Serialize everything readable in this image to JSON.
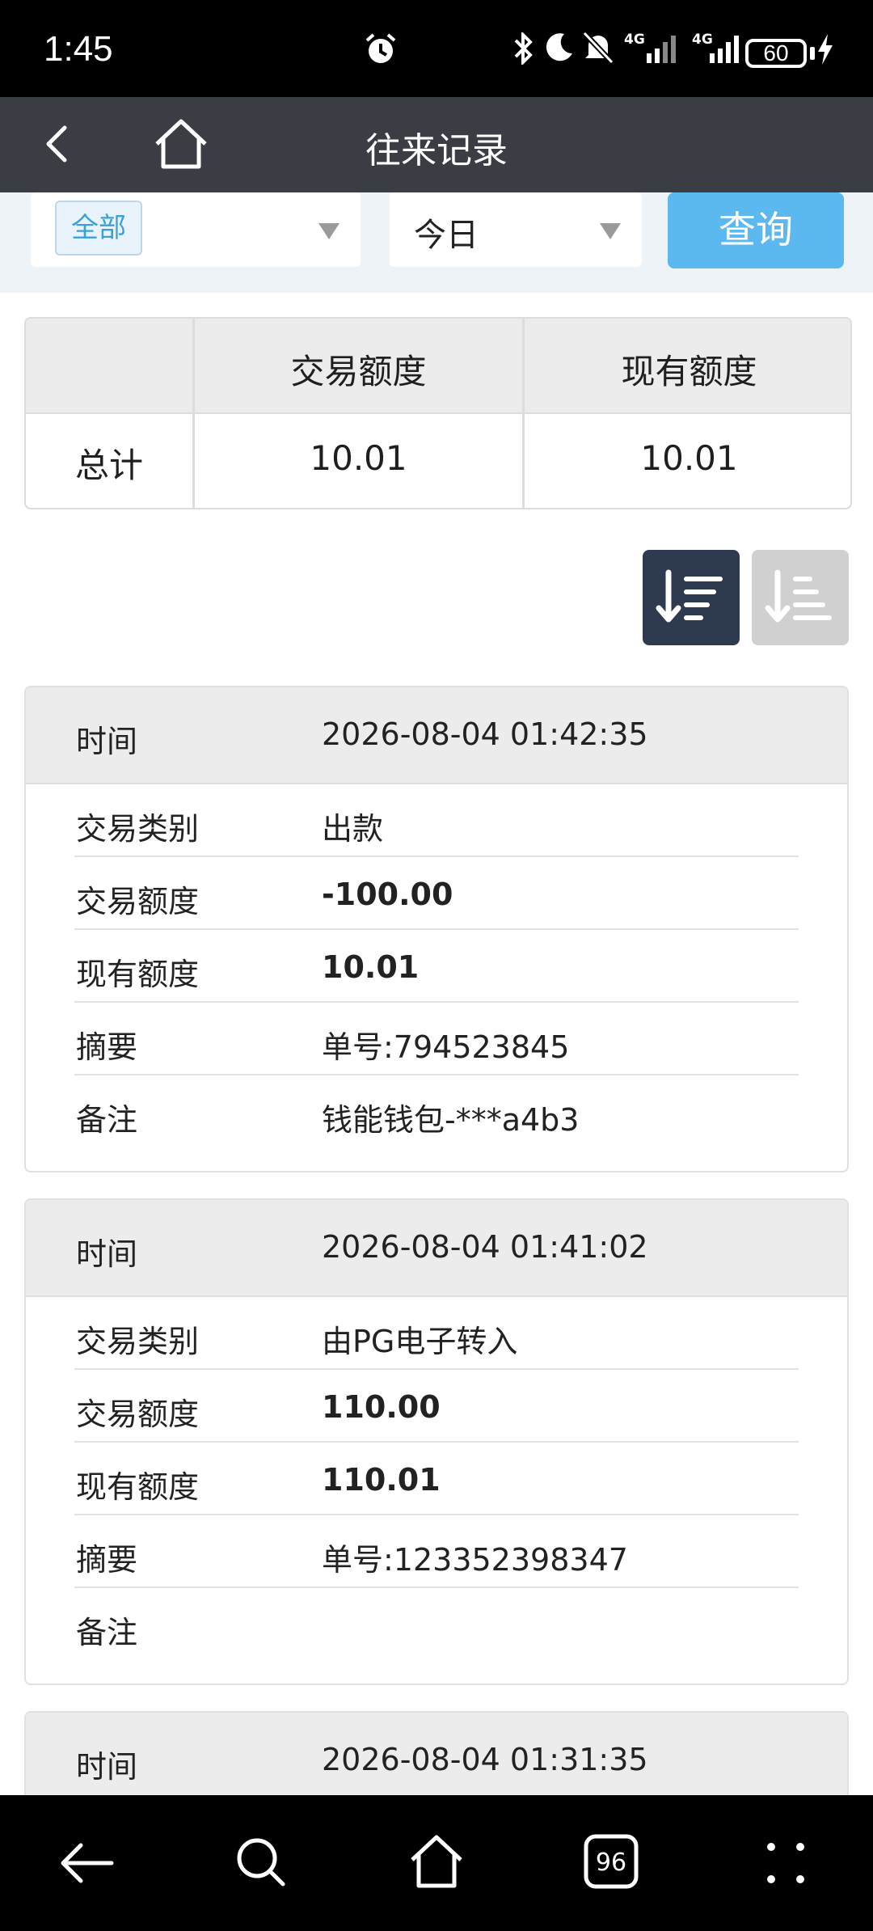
{
  "status_bar": {
    "time": "1:45",
    "network_1": "4G",
    "network_2": "4G",
    "battery": "60",
    "icons": [
      "alarm-icon",
      "bluetooth-icon",
      "moon-icon",
      "mute-icon",
      "signal-icon",
      "signal-icon",
      "charging-icon"
    ]
  },
  "header": {
    "title": "往来记录",
    "icons": [
      "back-icon",
      "home-icon"
    ]
  },
  "filters": {
    "category_tag": "全部",
    "date_value": "今日",
    "query_label": "查询"
  },
  "summary": {
    "col_trade": "交易额度",
    "col_current": "现有额度",
    "row_label": "总计",
    "trade_total": "10.01",
    "current_total": "10.01"
  },
  "sort": {
    "icons": [
      "sort-desc-icon",
      "sort-asc-icon"
    ],
    "active": "desc"
  },
  "labels": {
    "time": "时间",
    "type": "交易类别",
    "trade": "交易额度",
    "current": "现有额度",
    "summary": "摘要",
    "remark": "备注"
  },
  "records": [
    {
      "time": "2026-08-04 01:42:35",
      "type": "出款",
      "trade": "-100.00",
      "current": "10.01",
      "summary": "单号:794523845",
      "remark": "钱能钱包-***a4b3"
    },
    {
      "time": "2026-08-04 01:41:02",
      "type": "由PG电子转入",
      "trade": "110.00",
      "current": "110.01",
      "summary": "单号:123352398347",
      "remark": ""
    },
    {
      "time": "2026-08-04 01:31:35"
    }
  ],
  "nav_bar": {
    "tabs_count": "96",
    "icons": [
      "back-arrow-icon",
      "search-icon",
      "home-icon",
      "tabs-icon",
      "more-icon"
    ]
  }
}
